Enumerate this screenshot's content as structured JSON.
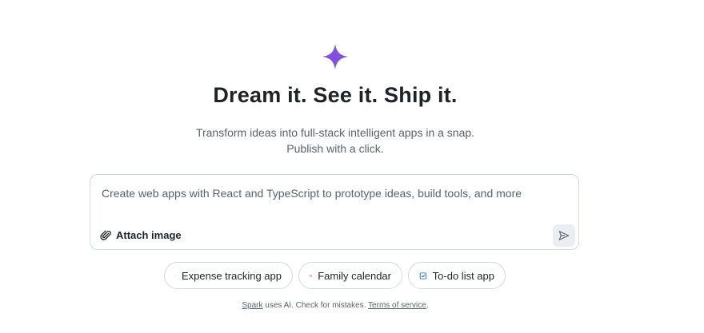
{
  "hero": {
    "title": "Dream it. See it. Ship it.",
    "subtitle_line1": "Transform ideas into full-stack intelligent apps in a snap.",
    "subtitle_line2": "Publish with a click."
  },
  "prompt": {
    "placeholder": "Create web apps with React and TypeScript to prototype ideas, build tools, and more",
    "attach_label": "Attach image"
  },
  "suggestions": [
    {
      "label": "Expense tracking app",
      "icon": "credit-card-icon",
      "color": "#1a7f37"
    },
    {
      "label": "Family calendar",
      "icon": "calendar-icon",
      "color": "#bf3989"
    },
    {
      "label": "To-do list app",
      "icon": "checkbox-icon",
      "color": "#0969da"
    }
  ],
  "footer": {
    "spark_link": "Spark",
    "middle_text": " uses AI. Check for mistakes. ",
    "terms_link": "Terms of service",
    "end_text": "."
  },
  "colors": {
    "accent": "#8250df",
    "border": "#d1d9e0",
    "muted_text": "#59636e"
  }
}
